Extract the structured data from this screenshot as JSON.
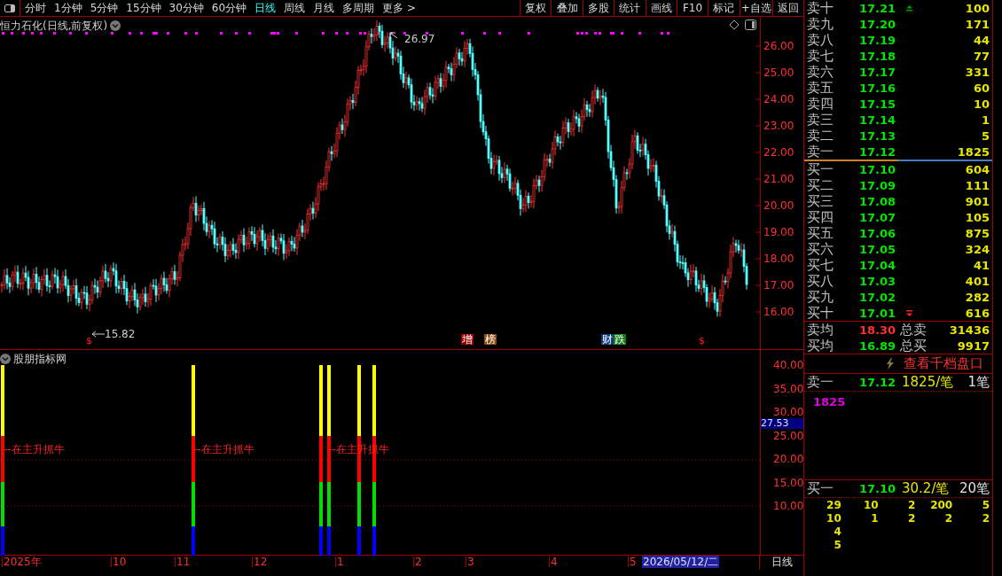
{
  "toolbar": {
    "periods": [
      {
        "label": "分时",
        "selected": false
      },
      {
        "label": "1分钟",
        "selected": false
      },
      {
        "label": "5分钟",
        "selected": false
      },
      {
        "label": "15分钟",
        "selected": false
      },
      {
        "label": "30分钟",
        "selected": false
      },
      {
        "label": "60分钟",
        "selected": false
      },
      {
        "label": "日线",
        "selected": true
      },
      {
        "label": "周线",
        "selected": false
      },
      {
        "label": "月线",
        "selected": false
      },
      {
        "label": "多周期",
        "selected": false
      },
      {
        "label": "更多 >",
        "selected": false
      }
    ],
    "actions": [
      "复权",
      "叠加",
      "多股",
      "统计",
      "画线",
      "F10",
      "标记",
      "+自选",
      "返回"
    ]
  },
  "chart": {
    "title": "恒力石化(日线,前复权)",
    "high_label": "26.97",
    "low_label": "15.82",
    "price_ticks": [
      "26.00",
      "25.00",
      "24.00",
      "23.00",
      "22.00",
      "21.00",
      "20.00",
      "19.00",
      "18.00",
      "17.00",
      "16.00"
    ],
    "markers": [
      "$",
      "$"
    ],
    "event_tags": [
      {
        "text": "增",
        "color": "#9b0000"
      },
      {
        "text": "榜",
        "color": "#8a4a10"
      },
      {
        "text": "财",
        "color": "#103a80"
      },
      {
        "text": "跌",
        "color": "#107a10"
      }
    ]
  },
  "indicator": {
    "title": "股朋指标网",
    "ticks": [
      "40.00",
      "35.00",
      "30.00",
      "25.00",
      "20.00",
      "15.00",
      "10.00"
    ],
    "current_value": "27.53",
    "signal_labels": [
      "--在主升抓牛",
      "--在主升抓牛",
      "--在主升抓牛"
    ]
  },
  "date_axis": {
    "labels": [
      "2025年",
      "10",
      "11",
      "12",
      "1",
      "2",
      "3",
      "4",
      "5"
    ],
    "cursor_date": "2026/05/12/二",
    "period": "日线"
  },
  "order_book": {
    "asks": [
      {
        "label": "卖十",
        "price": "17.21",
        "volume": "100"
      },
      {
        "label": "卖九",
        "price": "17.20",
        "volume": "171"
      },
      {
        "label": "卖八",
        "price": "17.19",
        "volume": "44"
      },
      {
        "label": "卖七",
        "price": "17.18",
        "volume": "77"
      },
      {
        "label": "卖六",
        "price": "17.17",
        "volume": "331"
      },
      {
        "label": "卖五",
        "price": "17.16",
        "volume": "60"
      },
      {
        "label": "卖四",
        "price": "17.15",
        "volume": "10"
      },
      {
        "label": "卖三",
        "price": "17.14",
        "volume": "1"
      },
      {
        "label": "卖二",
        "price": "17.13",
        "volume": "5"
      },
      {
        "label": "卖一",
        "price": "17.12",
        "volume": "1825"
      }
    ],
    "bids": [
      {
        "label": "买一",
        "price": "17.10",
        "volume": "604"
      },
      {
        "label": "买二",
        "price": "17.09",
        "volume": "111"
      },
      {
        "label": "买三",
        "price": "17.08",
        "volume": "901"
      },
      {
        "label": "买四",
        "price": "17.07",
        "volume": "105"
      },
      {
        "label": "买五",
        "price": "17.06",
        "volume": "875"
      },
      {
        "label": "买六",
        "price": "17.05",
        "volume": "324"
      },
      {
        "label": "买七",
        "price": "17.04",
        "volume": "41"
      },
      {
        "label": "买八",
        "price": "17.03",
        "volume": "401"
      },
      {
        "label": "买九",
        "price": "17.02",
        "volume": "282"
      },
      {
        "label": "买十",
        "price": "17.01",
        "volume": "616"
      }
    ],
    "summary": [
      {
        "label": "卖均",
        "price": "18.30",
        "up": true,
        "total_label": "总卖",
        "total": "31436"
      },
      {
        "label": "买均",
        "price": "16.89",
        "up": false,
        "total_label": "总买",
        "total": "9917"
      }
    ]
  },
  "depth_link": "查看千档盘口",
  "ask_queue": {
    "label": "卖一",
    "price": "17.12",
    "per_order": "1825/笔",
    "orders": "1笔",
    "items": [
      "1825"
    ]
  },
  "bid_queue": {
    "label": "买一",
    "price": "17.10",
    "per_order": "30.2/笔",
    "orders": "20笔",
    "rows": [
      [
        "29",
        "10",
        "2",
        "200",
        "5"
      ],
      [
        "10",
        "1",
        "2",
        "2",
        "2"
      ],
      [
        "4"
      ],
      [
        "5"
      ]
    ]
  }
}
